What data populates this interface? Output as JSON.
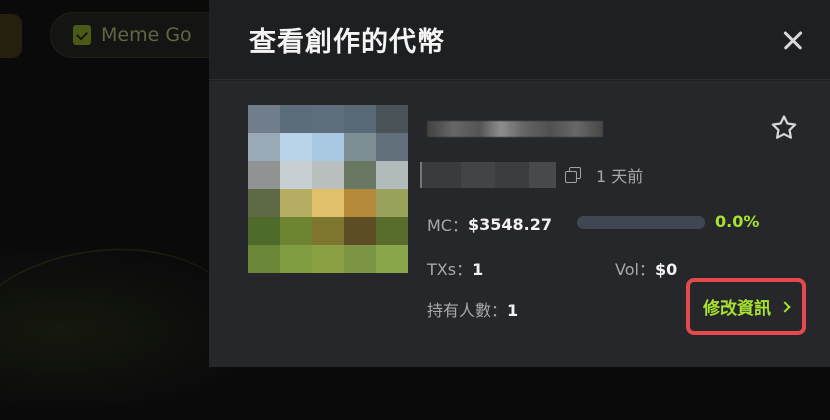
{
  "background": {
    "pill_label": "Meme Go"
  },
  "modal": {
    "title": "查看創作的代幣",
    "close_icon": "close-icon"
  },
  "token": {
    "time_ago": "1 天前",
    "market_cap_label": "MC：",
    "market_cap_value": "$3548.27",
    "progress_percent": "0.0%",
    "progress_fraction": 0.0,
    "txs_label": "TXs：",
    "txs_value": "1",
    "vol_label": "Vol：",
    "vol_value": "$0",
    "holders_label": "持有人數：",
    "holders_value": "1",
    "edit_label": "修改資訊"
  },
  "colors": {
    "accent_green": "#a6e22e",
    "highlight_red": "#e5484d",
    "progress_track": "#404753"
  },
  "token_image_pixels": [
    [
      "#6f7e8a",
      "#5b6c7a",
      "#5d6e7c",
      "#5a6976",
      "#4a5358"
    ],
    [
      "#9aa9b7",
      "#b9d3e8",
      "#a9c8e1",
      "#7d8e95",
      "#61707a"
    ],
    [
      "#8f9393",
      "#c8cfd2",
      "#b9bfbf",
      "#687862",
      "#b1bbbb"
    ],
    [
      "#5e6a44",
      "#b4ad62",
      "#e0c06a",
      "#b58a3a",
      "#9aa35b"
    ],
    [
      "#4f6b2b",
      "#6d8431",
      "#7f7630",
      "#5c4d24",
      "#586d2c"
    ],
    [
      "#6b8838",
      "#819d41",
      "#8aa043",
      "#7c9545",
      "#8aa64a"
    ]
  ]
}
